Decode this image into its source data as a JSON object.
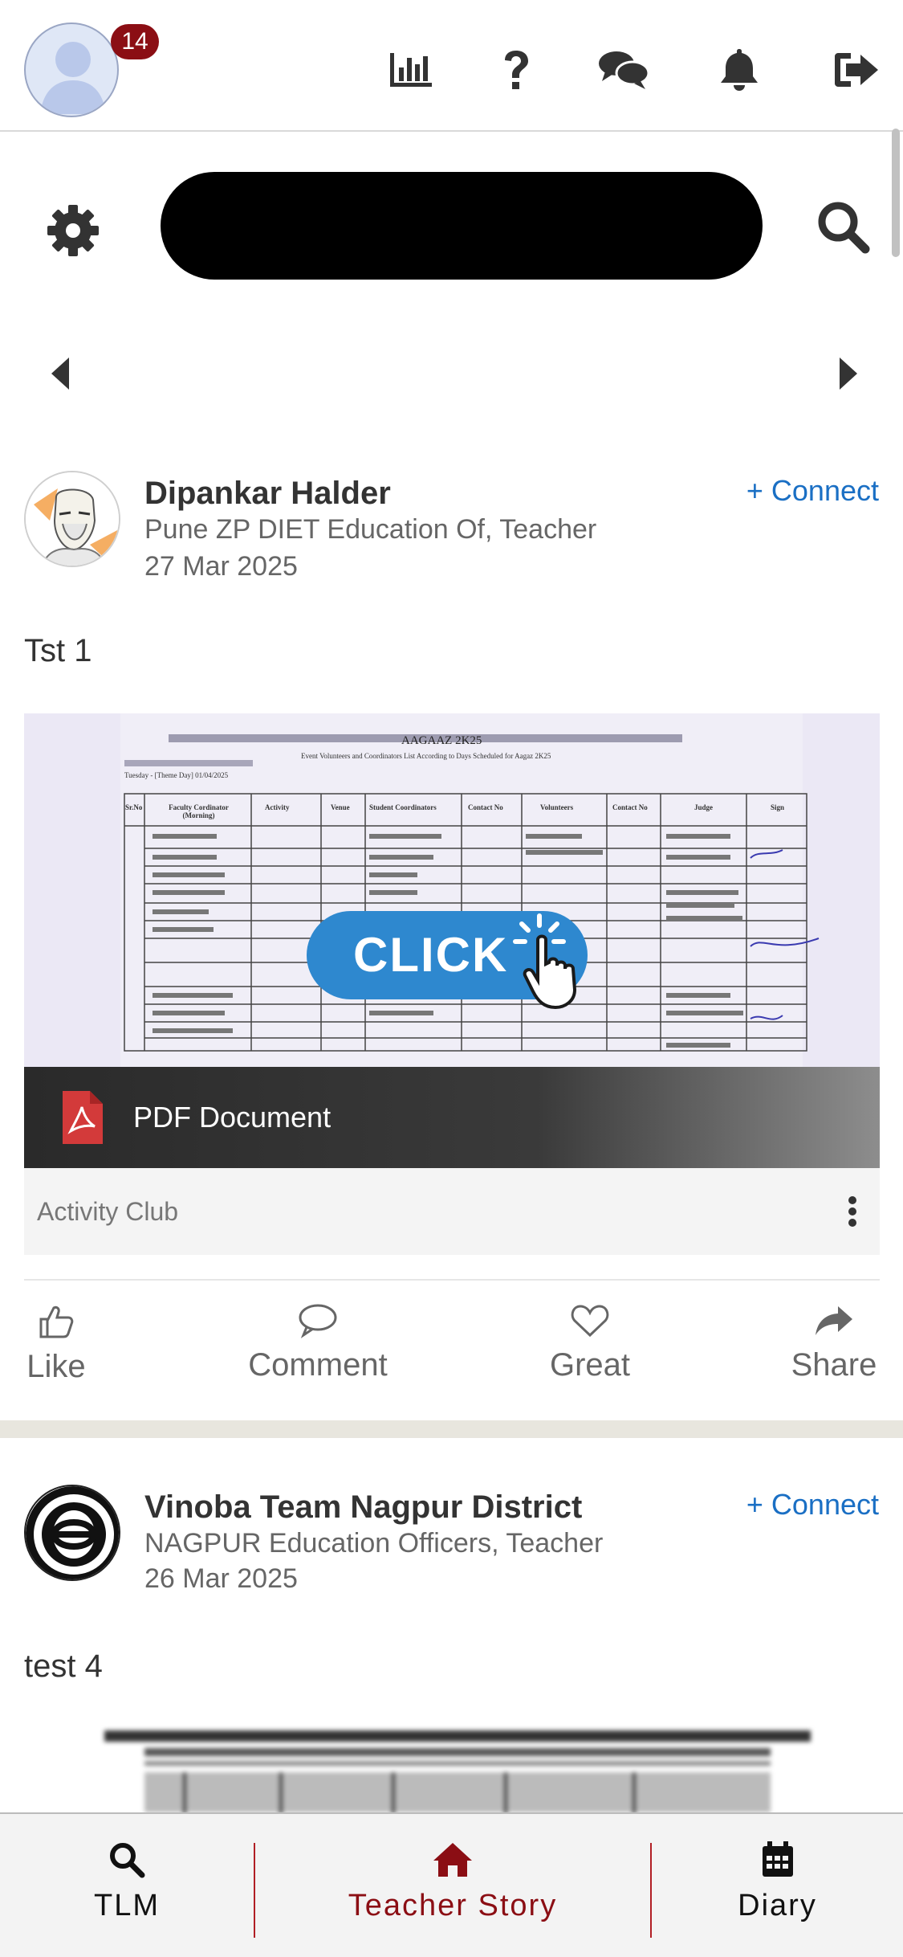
{
  "header": {
    "notification_count": "14",
    "icons": [
      "stats-chart-icon",
      "help-question-icon",
      "chat-icon",
      "bell-icon",
      "logout-icon"
    ]
  },
  "posts": [
    {
      "author": "Dipankar Halder",
      "organization": "Pune ZP DIET Education Of, Teacher",
      "date": "27 Mar 2025",
      "connect_label": "+ Connect",
      "text": "Tst 1",
      "document": {
        "doc_title": "AAGAAZ 2K25",
        "doc_subtitle": "Event Volunteers and Coordinators List According to Days Scheduled for Aagaz 2K25",
        "doc_day": "Tuesday - [Theme Day] 01/04/2025",
        "table_headers": [
          "Sr.No",
          "Faculty Cordinator (Morning)",
          "Activity",
          "Venue",
          "Student Coordinators",
          "Contact No",
          "Volunteers",
          "Contact No",
          "Judge",
          "Sign"
        ],
        "overlay_label": "CLICK",
        "type_label": "PDF Document"
      },
      "category": "Activity Club",
      "actions": {
        "like": "Like",
        "comment": "Comment",
        "great": "Great",
        "share": "Share"
      }
    },
    {
      "author": "Vinoba Team Nagpur District",
      "organization": "NAGPUR Education Officers, Teacher",
      "date": "26 Mar 2025",
      "connect_label": "+ Connect",
      "text": "test 4"
    }
  ],
  "bottom_nav": [
    {
      "label": "TLM",
      "icon": "search-icon",
      "active": false
    },
    {
      "label": "Teacher Story",
      "icon": "home-icon",
      "active": true
    },
    {
      "label": "Diary",
      "icon": "calendar-icon",
      "active": false
    }
  ],
  "colors": {
    "accent_red": "#8b0e14",
    "link_blue": "#1a6fc4",
    "click_blue": "#2e88cf",
    "pdf_red": "#d33a3a"
  }
}
